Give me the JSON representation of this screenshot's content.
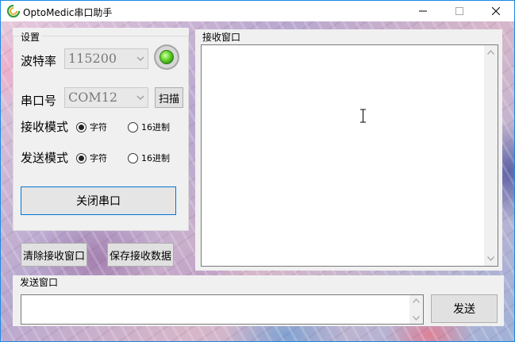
{
  "window": {
    "title": "OptoMedic串口助手",
    "icons": {
      "app": "app-logo-icon",
      "minimize": "minimize-icon",
      "maximize": "maximize-icon",
      "close": "close-icon"
    }
  },
  "settings": {
    "group_title": "设置",
    "baud_label": "波特率",
    "baud_value": "115200",
    "port_label": "串口号",
    "port_value": "COM12",
    "scan_button": "扫描",
    "receive_mode_label": "接收模式",
    "receive_mode_options": [
      "字符",
      "16进制"
    ],
    "receive_mode_selected": "字符",
    "send_mode_label": "发送模式",
    "send_mode_options": [
      "字符",
      "16进制"
    ],
    "send_mode_selected": "字符",
    "toggle_port_button": "关闭串口",
    "status_led": {
      "state": "on",
      "color": "#5ccf2a"
    }
  },
  "actions": {
    "clear_receive": "清除接收窗口",
    "save_receive": "保存接收数据"
  },
  "receive": {
    "group_title": "接收窗口",
    "content": ""
  },
  "send": {
    "group_title": "发送窗口",
    "content": "",
    "send_button": "发送"
  },
  "colors": {
    "accent": "#0078d7",
    "panel_bg": "#f0f0f0"
  }
}
